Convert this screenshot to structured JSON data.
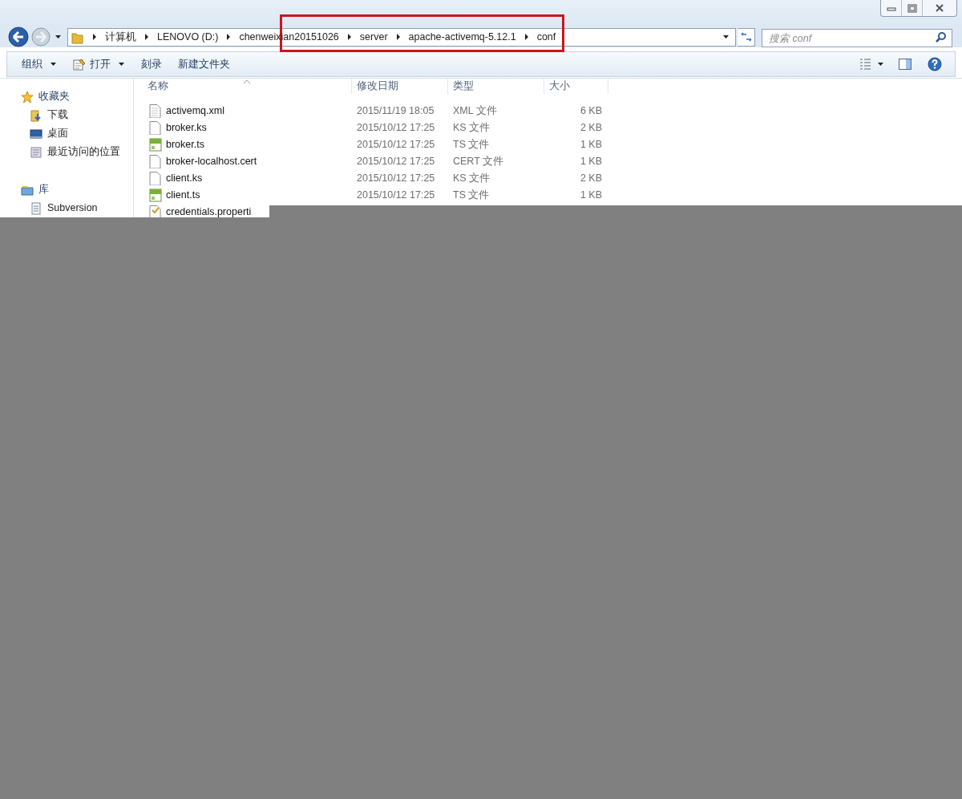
{
  "breadcrumb": [
    "计算机",
    "LENOVO (D:)",
    "chenweixian20151026",
    "server",
    "apache-activemq-5.12.1",
    "conf"
  ],
  "search": {
    "placeholder": "搜索 conf"
  },
  "toolbar": [
    {
      "label": "组织",
      "dropdown": true
    },
    {
      "label": "打开",
      "dropdown": true
    },
    {
      "label": "刻录",
      "dropdown": false
    },
    {
      "label": "新建文件夹",
      "dropdown": false
    }
  ],
  "sidebar": {
    "groups": [
      {
        "label": "收藏夹",
        "items": [
          {
            "label": "下载"
          },
          {
            "label": "桌面"
          },
          {
            "label": "最近访问的位置"
          }
        ]
      },
      {
        "label": "库",
        "items": [
          {
            "label": "Subversion"
          }
        ]
      }
    ]
  },
  "table": {
    "columns": [
      "名称",
      "修改日期",
      "类型",
      "大小"
    ],
    "rows": [
      {
        "name": "activemq.xml",
        "date": "2015/11/19 18:05",
        "type": "XML 文件",
        "size": "6 KB"
      },
      {
        "name": "broker.ks",
        "date": "2015/10/12 17:25",
        "type": "KS 文件",
        "size": "2 KB"
      },
      {
        "name": "broker.ts",
        "date": "2015/10/12 17:25",
        "type": "TS 文件",
        "size": "1 KB"
      },
      {
        "name": "broker-localhost.cert",
        "date": "2015/10/12 17:25",
        "type": "CERT 文件",
        "size": "1 KB"
      },
      {
        "name": "client.ks",
        "date": "2015/10/12 17:25",
        "type": "KS 文件",
        "size": "2 KB"
      },
      {
        "name": "client.ts",
        "date": "2015/10/12 17:25",
        "type": "TS 文件",
        "size": "1 KB"
      },
      {
        "name": "credentials.properti"
      }
    ]
  }
}
